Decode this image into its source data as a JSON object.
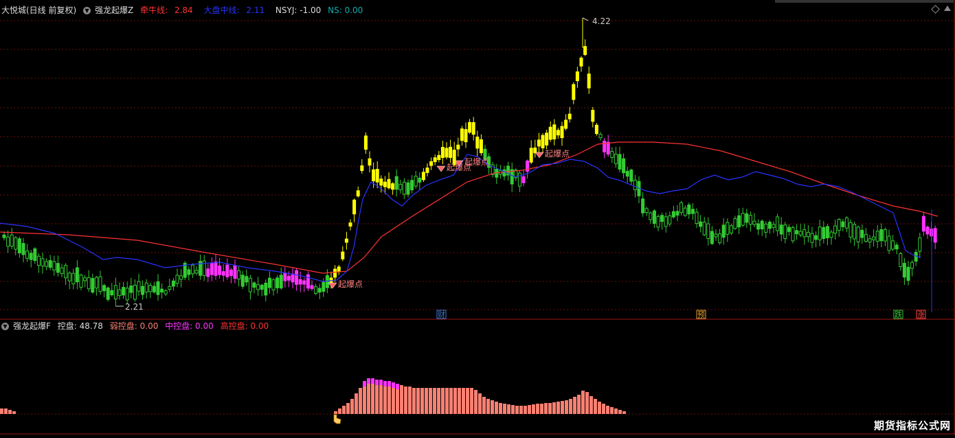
{
  "main_header": {
    "stock": "大悦城(日线 前复权)",
    "indicator": "强龙起爆Z",
    "bull_label": "牵牛线:",
    "bull_value": "2.84",
    "mid_label": "大盘中线:",
    "mid_value": "2.11",
    "nsyj": "NSYJ: -1.00",
    "ns": "NS: 0.00"
  },
  "sub_header": {
    "indicator": "强龙起爆F",
    "ctrl": "控盘: 48.78",
    "weak": "弱控盘: 0.00",
    "medium": "中控盘: 0.00",
    "high": "高控盘: 0.00"
  },
  "annotations": {
    "high_price": "4.22",
    "low_price": "2.21",
    "burst_label": "起爆点",
    "burst_label_cut": "起爆点",
    "burst_label_3": "起爆点"
  },
  "event_markers": [
    {
      "label": "财",
      "color": "#3a7bd5"
    },
    {
      "label": "预",
      "color": "#e0a030"
    },
    {
      "label": "跌",
      "color": "#33cc33"
    },
    {
      "label": "涨",
      "color": "#ff4444"
    }
  ],
  "watermark": "期货指标公式网",
  "colors": {
    "background": "#000000",
    "grid": "#6b1010",
    "candle_green": "#33cc33",
    "candle_yellow": "#ffff00",
    "candle_magenta": "#ff33ff",
    "bull_line": "#ff3333",
    "mid_line": "#2a33ff",
    "bar_salmon": "#fa8072",
    "bar_top": "#ff33ff"
  },
  "chart_data": {
    "type": "candlestick",
    "price_range": [
      2.1,
      4.3
    ],
    "high": 4.22,
    "low": 2.21
  }
}
